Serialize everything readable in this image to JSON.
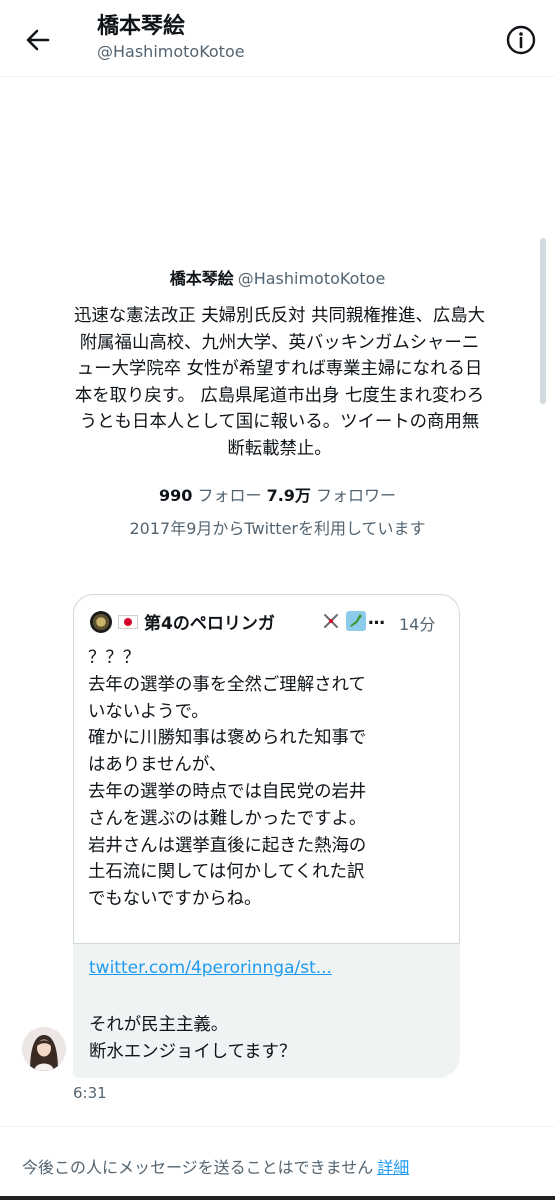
{
  "header": {
    "title": "橋本琴絵",
    "handle": "@HashimotoKotoe",
    "back_icon": "arrow-left-icon",
    "info_icon": "info-circle-icon"
  },
  "profile": {
    "name": "橋本琴絵",
    "handle": "@HashimotoKotoe",
    "bio": "迅速な憲法改正 夫婦別氏反対 共同親権推進、広島大\n附属福山高校、九州大学、英バッキンガムシャーニ\nュー大学院卒 女性が希望すれば専業主婦になれる日\n本を取り戻す。 広島県尾道市出身 七度生まれ変わろ\nうとも日本人として国に報いる。ツイートの商用無\n断転載禁止。",
    "following_count": "990",
    "following_label": "フォロー",
    "followers_count": "7.9万",
    "followers_label": "フォロワー",
    "joined": "2017年9月からTwitterを利用しています"
  },
  "message": {
    "quoted_tweet": {
      "author_name": "第4のペロリンガ",
      "ellipsis": "…",
      "time": "14分",
      "text": "？？？\n去年の選挙の事を全然ご理解されて\nいないようで。\n確かに川勝知事は褒められた知事で\nはありませんが、\n去年の選挙の時点では自民党の岩井\nさんを選ぶのは難しかったですよ。\n岩井さんは選挙直後に起きた熱海の\n土石流に関しては何かしてくれた訳\nでもないですからね。"
    },
    "link": "twitter.com/4perorinnga/st...",
    "text": "それが民主主義。\n断水エンジョイしてます？",
    "timestamp": "6:31"
  },
  "footer": {
    "notice": "今後この人にメッセージを送ることはできません",
    "details_link": "詳細"
  },
  "colors": {
    "accent": "#1d9bf0",
    "text": "#0f1419",
    "secondary_text": "#536471",
    "bubble_bg": "#eff3f4"
  }
}
